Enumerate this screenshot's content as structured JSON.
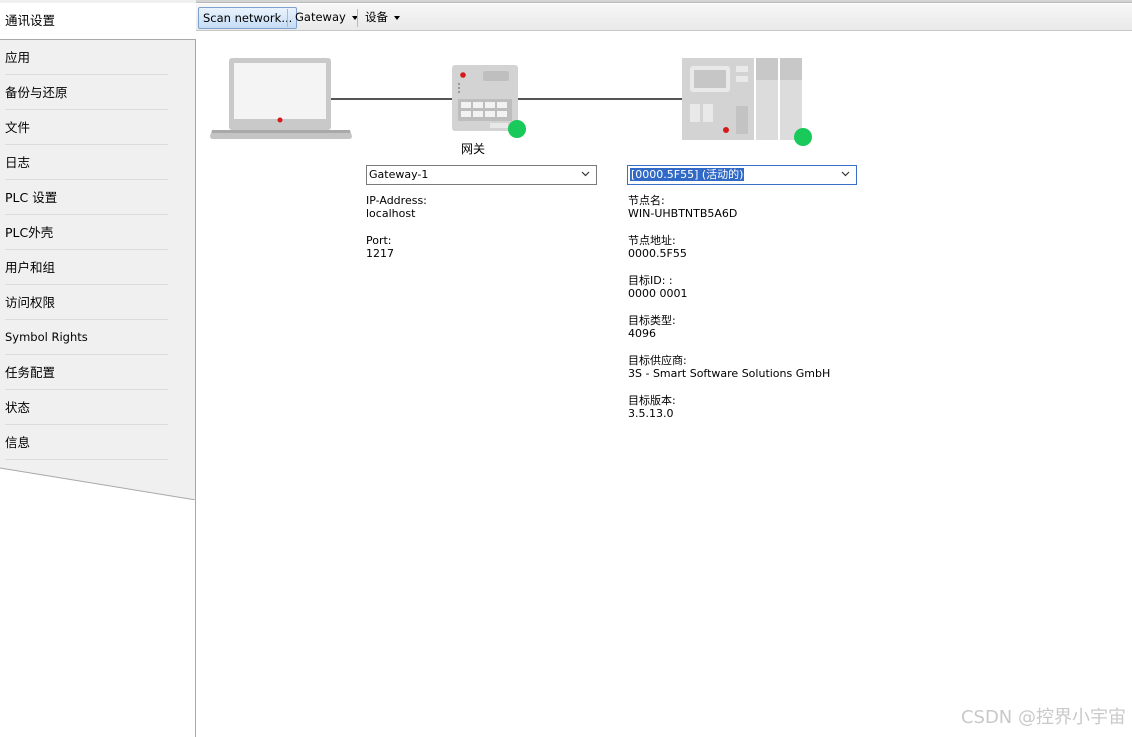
{
  "sidebar": {
    "items": [
      {
        "label": "通讯设置"
      },
      {
        "label": "应用"
      },
      {
        "label": "备份与还原"
      },
      {
        "label": "文件"
      },
      {
        "label": "日志"
      },
      {
        "label": "PLC 设置"
      },
      {
        "label": "PLC外壳"
      },
      {
        "label": "用户和组"
      },
      {
        "label": "访问权限"
      },
      {
        "label": "Symbol Rights"
      },
      {
        "label": "任务配置"
      },
      {
        "label": "状态"
      },
      {
        "label": "信息"
      }
    ]
  },
  "toolbar": {
    "scan_label": "Scan network...",
    "gateway_label": "Gateway",
    "device_label": "设备"
  },
  "topology": {
    "gateway_caption": "网关",
    "status_color": "#19c95a"
  },
  "gateway_panel": {
    "combo_value": "Gateway-1",
    "ip_label": "IP-Address:",
    "ip_value": "localhost",
    "port_label": "Port:",
    "port_value": "1217"
  },
  "device_panel": {
    "combo_value": "[0000.5F55] (活动的)",
    "fields": [
      {
        "label": "节点名:",
        "value": "WIN-UHBTNTB5A6D"
      },
      {
        "label": "节点地址:",
        "value": "0000.5F55"
      },
      {
        "label": "目标ID: :",
        "value": "0000 0001"
      },
      {
        "label": "目标类型:",
        "value": "4096"
      },
      {
        "label": "目标供应商:",
        "value": "3S - Smart Software Solutions GmbH"
      },
      {
        "label": "目标版本:",
        "value": "3.5.13.0"
      }
    ]
  },
  "watermark": "CSDN @控界小宇宙"
}
